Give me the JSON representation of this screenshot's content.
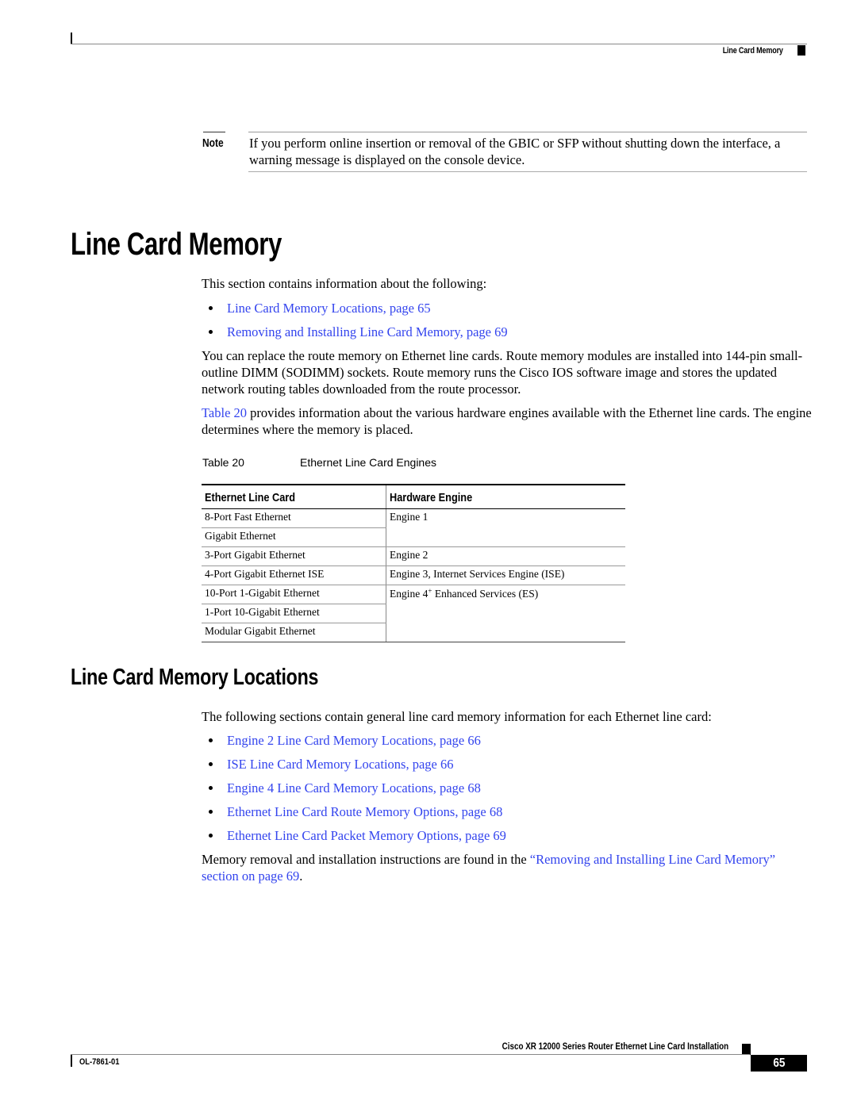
{
  "header": {
    "running_title": "Line Card Memory"
  },
  "note": {
    "label": "Note",
    "text": "If you perform online insertion or removal of the GBIC or SFP without shutting down the interface, a warning message is displayed on the console device."
  },
  "section1": {
    "title": "Line Card Memory",
    "intro": "This section contains information about the following:",
    "links": [
      "Line Card Memory Locations, page 65",
      "Removing and Installing Line Card Memory, page 69"
    ],
    "para1": "You can replace the route memory on Ethernet line cards. Route memory modules are installed into 144-pin small-outline DIMM (SODIMM) sockets. Route memory runs the Cisco IOS software image and stores the updated network routing tables downloaded from the route processor.",
    "para2_link": "Table 20",
    "para2_rest": " provides information about the various hardware engines available with the Ethernet line cards. The engine determines where the memory is placed."
  },
  "table": {
    "number": "Table 20",
    "caption": "Ethernet Line Card Engines",
    "headers": [
      "Ethernet Line Card",
      "Hardware Engine"
    ],
    "rows": [
      {
        "card": "8-Port Fast Ethernet",
        "engine": "Engine 1"
      },
      {
        "card": "Gigabit Ethernet",
        "engine": ""
      },
      {
        "card": "3-Port Gigabit Ethernet",
        "engine": "Engine 2"
      },
      {
        "card": "4-Port Gigabit Ethernet ISE",
        "engine": "Engine 3, Internet Services Engine (ISE)"
      },
      {
        "card": "10-Port 1-Gigabit Ethernet",
        "engine_pre": "Engine 4",
        "engine_sup": "+",
        "engine_post": " Enhanced Services (ES)"
      },
      {
        "card": "1-Port 10-Gigabit Ethernet",
        "engine": ""
      },
      {
        "card": "Modular Gigabit Ethernet",
        "engine": ""
      }
    ]
  },
  "section2": {
    "title": "Line Card Memory Locations",
    "intro": "The following sections contain general line card memory information for each Ethernet line card:",
    "links": [
      "Engine 2 Line Card Memory Locations, page 66",
      "ISE Line Card Memory Locations, page 66",
      "Engine 4 Line Card Memory Locations, page 68",
      "Ethernet Line Card Route Memory Options, page 68",
      "Ethernet Line Card Packet Memory Options, page 69"
    ],
    "closing_pre": "Memory removal and installation instructions are found in the ",
    "closing_link": "“Removing and Installing Line Card Memory” section on page 69",
    "closing_post": "."
  },
  "footer": {
    "book_title": "Cisco XR 12000 Series Router Ethernet Line Card Installation",
    "doc_number": "OL-7861-01",
    "page_number": "65"
  },
  "colors": {
    "link": "#3344ee",
    "text": "#000000"
  }
}
